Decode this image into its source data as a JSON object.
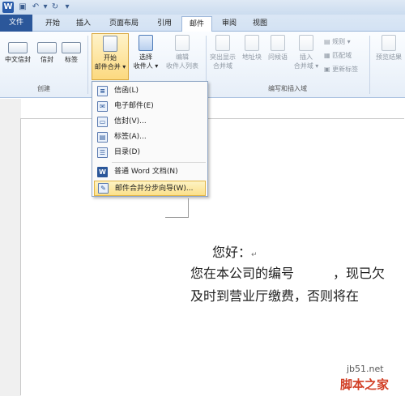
{
  "titlebar": {
    "app_icon": "W"
  },
  "tabs": [
    {
      "label": "文件"
    },
    {
      "label": "开始"
    },
    {
      "label": "插入"
    },
    {
      "label": "页面布局"
    },
    {
      "label": "引用"
    },
    {
      "label": "邮件"
    },
    {
      "label": "审阅"
    },
    {
      "label": "视图"
    }
  ],
  "ribbon": {
    "create": {
      "chinese_envelope": "中文信封",
      "envelope": "信封",
      "labels": "标签",
      "group_label": "创建"
    },
    "start_merge": {
      "line1": "开始",
      "line2": "邮件合并 ▾"
    },
    "select_recipients": {
      "line1": "选择",
      "line2": "收件人 ▾"
    },
    "edit_recipients": {
      "line1": "编辑",
      "line2": "收件人列表"
    },
    "write_insert": {
      "highlight_fields": [
        "突出显示",
        "合并域"
      ],
      "address_block": "地址块",
      "greeting": "问候语",
      "insert_field": [
        "插入",
        "合并域 ▾"
      ],
      "rules": "规则 ▾",
      "match_fields": "匹配域",
      "update_labels": "更新标签",
      "group_label": "编写和插入域"
    },
    "preview_results": "预览结果"
  },
  "dropdown": {
    "items": [
      {
        "label": "信函(L)"
      },
      {
        "label": "电子邮件(E)"
      },
      {
        "label": "信封(V)..."
      },
      {
        "label": "标签(A)..."
      },
      {
        "label": "目录(D)"
      },
      {
        "label": "普通 Word 文档(N)"
      },
      {
        "label": "邮件合并分步向导(W)..."
      }
    ]
  },
  "document": {
    "line1": "您好：",
    "line2": "您在本公司的编号　　　，现已欠",
    "line3": "及时到营业厅缴费，否则将在"
  },
  "watermark": {
    "site": "jb51.net",
    "name": "脚本之家"
  }
}
